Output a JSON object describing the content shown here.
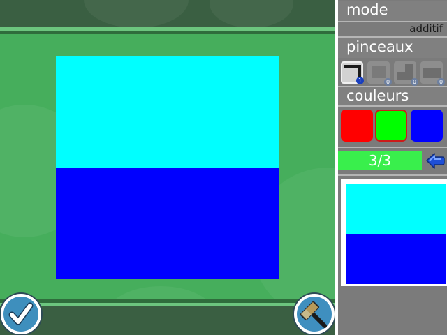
{
  "panel": {
    "mode_title": "mode",
    "mode_value": "additif",
    "brushes_title": "pinceaux",
    "colors_title": "couleurs",
    "brushes": [
      {
        "name": "brush-1",
        "badge": "1",
        "active": true
      },
      {
        "name": "brush-2",
        "badge": "0",
        "active": false
      },
      {
        "name": "brush-3",
        "badge": "0",
        "active": false
      },
      {
        "name": "brush-4",
        "badge": "0",
        "active": false
      }
    ],
    "colors": [
      {
        "name": "red",
        "hex": "#ff0000",
        "selected": false
      },
      {
        "name": "green",
        "hex": "#00ff00",
        "selected": true
      },
      {
        "name": "blue",
        "hex": "#0000ff",
        "selected": false
      }
    ],
    "progress": "3/3"
  },
  "canvas": {
    "bands": [
      "#00ffff",
      "#0000ff"
    ]
  },
  "target_preview": {
    "bands": [
      "#00ffff",
      "#0000ff"
    ]
  },
  "colors": {
    "stage_bg": "#46ae5c",
    "panel_bg": "#7b7b7b",
    "progress_bg": "#39ef4c",
    "button_blue": "#3e8fbd"
  },
  "icons": {
    "validate": "checkmark-icon",
    "hammer": "hammer-icon",
    "undo": "arrow-left-icon"
  }
}
